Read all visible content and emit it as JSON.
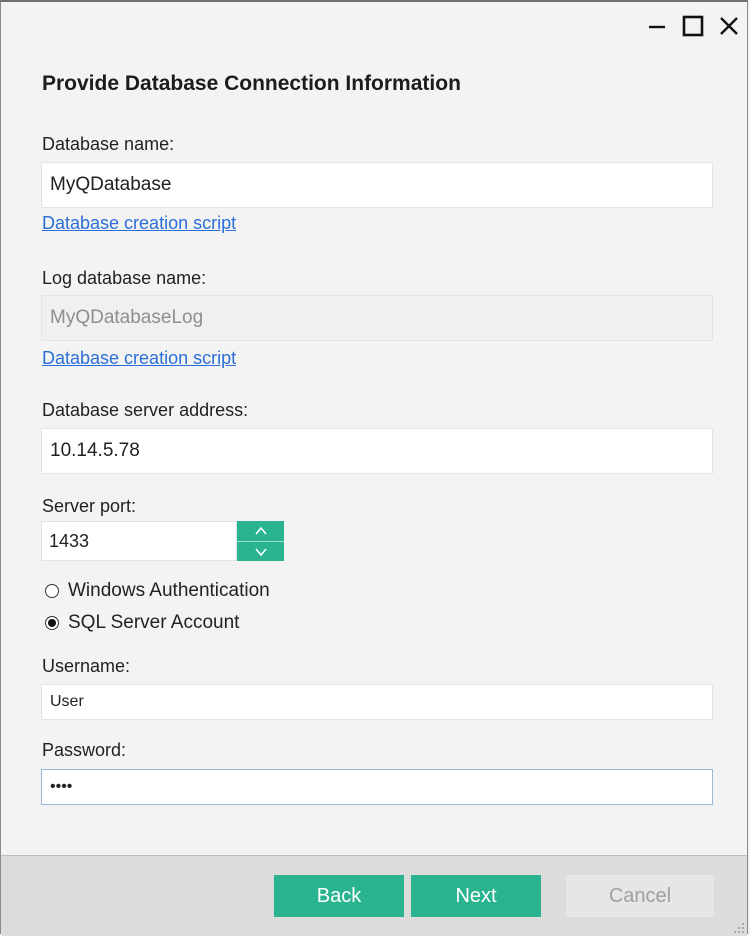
{
  "window": {
    "minimize_icon": "minimize-icon",
    "maximize_icon": "maximize-icon",
    "close_icon": "close-icon"
  },
  "form": {
    "heading": "Provide Database Connection Information",
    "database_name": {
      "label": "Database name:",
      "value": "MyQDatabase",
      "link": "Database creation script"
    },
    "log_database_name": {
      "label": "Log database name:",
      "value": "MyQDatabaseLog",
      "link": "Database creation script",
      "disabled": true
    },
    "server_address": {
      "label": "Database server address:",
      "value": "10.14.5.78"
    },
    "server_port": {
      "label": "Server port:",
      "value": "1433",
      "up_glyph": "^",
      "down_glyph": "v"
    },
    "auth": {
      "options": [
        {
          "label": "Windows Authentication",
          "checked": false
        },
        {
          "label": "SQL Server Account",
          "checked": true
        }
      ]
    },
    "username": {
      "label": "Username:",
      "value": "User"
    },
    "password": {
      "label": "Password:",
      "value": "••••"
    }
  },
  "footer": {
    "back_label": "Back",
    "next_label": "Next",
    "cancel_label": "Cancel"
  },
  "colors": {
    "accent": "#2ab38f",
    "link": "#2b6fd6",
    "footer_bg": "#dcdcdc"
  }
}
